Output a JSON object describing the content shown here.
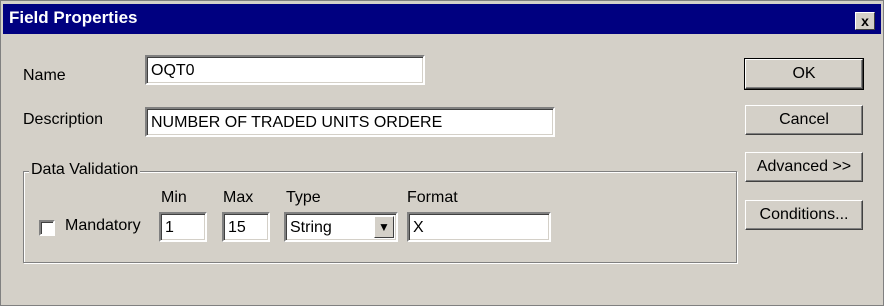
{
  "window": {
    "title": "Field Properties",
    "close_label": "x"
  },
  "form": {
    "name_label": "Name",
    "name_value": "OQT0",
    "description_label": "Description",
    "description_value": "NUMBER OF TRADED UNITS ORDERE"
  },
  "validation": {
    "group_label": "Data Validation",
    "mandatory_label": "Mandatory",
    "mandatory_checked": false,
    "min_label": "Min",
    "min_value": "1",
    "max_label": "Max",
    "max_value": "15",
    "type_label": "Type",
    "type_value": "String",
    "format_label": "Format",
    "format_value": "X"
  },
  "buttons": {
    "ok": "OK",
    "cancel": "Cancel",
    "advanced": "Advanced >>",
    "conditions": "Conditions..."
  },
  "colors": {
    "titlebar": "#000080",
    "face": "#d4d0c8"
  },
  "icons": {
    "close": "close-icon",
    "dropdown": "dropdown-arrow-icon"
  }
}
